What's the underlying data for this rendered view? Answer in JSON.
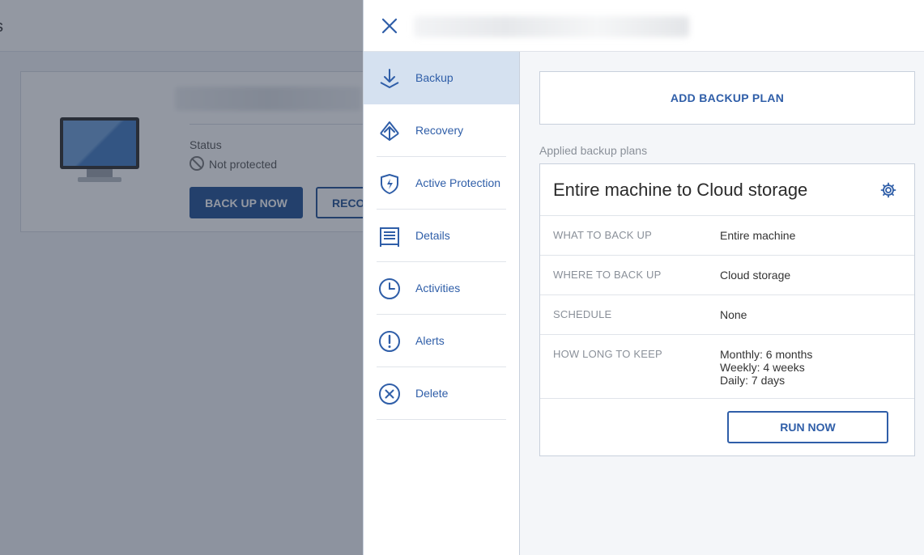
{
  "background": {
    "header_title_fragment": "s",
    "card": {
      "status_label": "Status",
      "status_value": "Not protected",
      "backup_now_label": "BACK UP NOW",
      "recovery_label": "RECO"
    }
  },
  "panel": {
    "nav": [
      {
        "label": "Backup",
        "icon": "backup-icon",
        "active": true
      },
      {
        "label": "Recovery",
        "icon": "recovery-icon",
        "active": false
      },
      {
        "label": "Active Protection",
        "icon": "shield-icon",
        "active": false
      },
      {
        "label": "Details",
        "icon": "details-icon",
        "active": false
      },
      {
        "label": "Activities",
        "icon": "clock-icon",
        "active": false
      },
      {
        "label": "Alerts",
        "icon": "alert-icon",
        "active": false
      },
      {
        "label": "Delete",
        "icon": "delete-icon",
        "active": false
      }
    ],
    "add_plan_label": "ADD BACKUP PLAN",
    "applied_label": "Applied backup plans",
    "plan": {
      "title": "Entire machine to Cloud storage",
      "rows": [
        {
          "key": "WHAT TO BACK UP",
          "value": [
            "Entire machine"
          ]
        },
        {
          "key": "WHERE TO BACK UP",
          "value": [
            "Cloud storage"
          ]
        },
        {
          "key": "SCHEDULE",
          "value": [
            "None"
          ]
        },
        {
          "key": "HOW LONG TO KEEP",
          "value": [
            "Monthly: 6 months",
            "Weekly: 4 weeks",
            "Daily: 7 days"
          ]
        }
      ],
      "run_now_label": "RUN NOW"
    }
  },
  "colors": {
    "accent": "#2f5ea8",
    "primary_button": "#1f4f92",
    "active_nav": "#d5e1f0"
  }
}
